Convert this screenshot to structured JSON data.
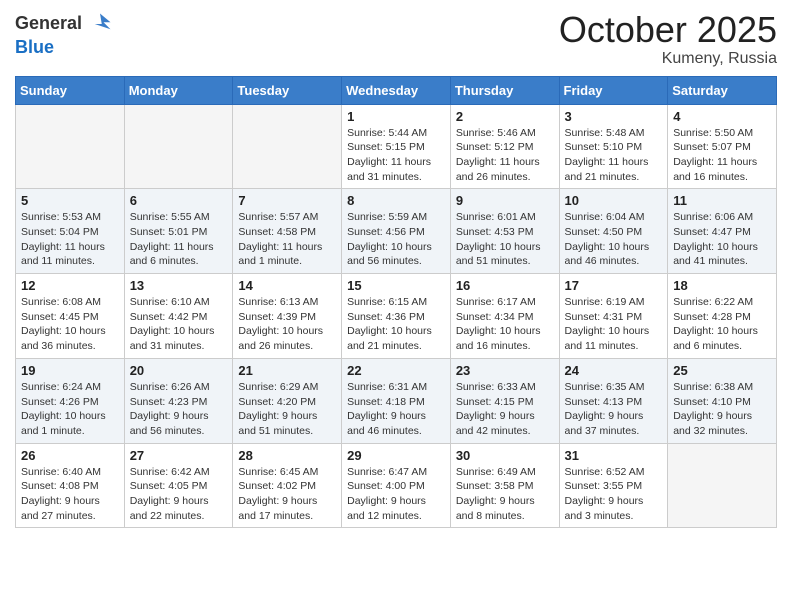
{
  "header": {
    "logo_general": "General",
    "logo_blue": "Blue",
    "month": "October 2025",
    "location": "Kumeny, Russia"
  },
  "weekdays": [
    "Sunday",
    "Monday",
    "Tuesday",
    "Wednesday",
    "Thursday",
    "Friday",
    "Saturday"
  ],
  "weeks": [
    [
      {
        "day": "",
        "info": ""
      },
      {
        "day": "",
        "info": ""
      },
      {
        "day": "",
        "info": ""
      },
      {
        "day": "1",
        "info": "Sunrise: 5:44 AM\nSunset: 5:15 PM\nDaylight: 11 hours\nand 31 minutes."
      },
      {
        "day": "2",
        "info": "Sunrise: 5:46 AM\nSunset: 5:12 PM\nDaylight: 11 hours\nand 26 minutes."
      },
      {
        "day": "3",
        "info": "Sunrise: 5:48 AM\nSunset: 5:10 PM\nDaylight: 11 hours\nand 21 minutes."
      },
      {
        "day": "4",
        "info": "Sunrise: 5:50 AM\nSunset: 5:07 PM\nDaylight: 11 hours\nand 16 minutes."
      }
    ],
    [
      {
        "day": "5",
        "info": "Sunrise: 5:53 AM\nSunset: 5:04 PM\nDaylight: 11 hours\nand 11 minutes."
      },
      {
        "day": "6",
        "info": "Sunrise: 5:55 AM\nSunset: 5:01 PM\nDaylight: 11 hours\nand 6 minutes."
      },
      {
        "day": "7",
        "info": "Sunrise: 5:57 AM\nSunset: 4:58 PM\nDaylight: 11 hours\nand 1 minute."
      },
      {
        "day": "8",
        "info": "Sunrise: 5:59 AM\nSunset: 4:56 PM\nDaylight: 10 hours\nand 56 minutes."
      },
      {
        "day": "9",
        "info": "Sunrise: 6:01 AM\nSunset: 4:53 PM\nDaylight: 10 hours\nand 51 minutes."
      },
      {
        "day": "10",
        "info": "Sunrise: 6:04 AM\nSunset: 4:50 PM\nDaylight: 10 hours\nand 46 minutes."
      },
      {
        "day": "11",
        "info": "Sunrise: 6:06 AM\nSunset: 4:47 PM\nDaylight: 10 hours\nand 41 minutes."
      }
    ],
    [
      {
        "day": "12",
        "info": "Sunrise: 6:08 AM\nSunset: 4:45 PM\nDaylight: 10 hours\nand 36 minutes."
      },
      {
        "day": "13",
        "info": "Sunrise: 6:10 AM\nSunset: 4:42 PM\nDaylight: 10 hours\nand 31 minutes."
      },
      {
        "day": "14",
        "info": "Sunrise: 6:13 AM\nSunset: 4:39 PM\nDaylight: 10 hours\nand 26 minutes."
      },
      {
        "day": "15",
        "info": "Sunrise: 6:15 AM\nSunset: 4:36 PM\nDaylight: 10 hours\nand 21 minutes."
      },
      {
        "day": "16",
        "info": "Sunrise: 6:17 AM\nSunset: 4:34 PM\nDaylight: 10 hours\nand 16 minutes."
      },
      {
        "day": "17",
        "info": "Sunrise: 6:19 AM\nSunset: 4:31 PM\nDaylight: 10 hours\nand 11 minutes."
      },
      {
        "day": "18",
        "info": "Sunrise: 6:22 AM\nSunset: 4:28 PM\nDaylight: 10 hours\nand 6 minutes."
      }
    ],
    [
      {
        "day": "19",
        "info": "Sunrise: 6:24 AM\nSunset: 4:26 PM\nDaylight: 10 hours\nand 1 minute."
      },
      {
        "day": "20",
        "info": "Sunrise: 6:26 AM\nSunset: 4:23 PM\nDaylight: 9 hours\nand 56 minutes."
      },
      {
        "day": "21",
        "info": "Sunrise: 6:29 AM\nSunset: 4:20 PM\nDaylight: 9 hours\nand 51 minutes."
      },
      {
        "day": "22",
        "info": "Sunrise: 6:31 AM\nSunset: 4:18 PM\nDaylight: 9 hours\nand 46 minutes."
      },
      {
        "day": "23",
        "info": "Sunrise: 6:33 AM\nSunset: 4:15 PM\nDaylight: 9 hours\nand 42 minutes."
      },
      {
        "day": "24",
        "info": "Sunrise: 6:35 AM\nSunset: 4:13 PM\nDaylight: 9 hours\nand 37 minutes."
      },
      {
        "day": "25",
        "info": "Sunrise: 6:38 AM\nSunset: 4:10 PM\nDaylight: 9 hours\nand 32 minutes."
      }
    ],
    [
      {
        "day": "26",
        "info": "Sunrise: 6:40 AM\nSunset: 4:08 PM\nDaylight: 9 hours\nand 27 minutes."
      },
      {
        "day": "27",
        "info": "Sunrise: 6:42 AM\nSunset: 4:05 PM\nDaylight: 9 hours\nand 22 minutes."
      },
      {
        "day": "28",
        "info": "Sunrise: 6:45 AM\nSunset: 4:02 PM\nDaylight: 9 hours\nand 17 minutes."
      },
      {
        "day": "29",
        "info": "Sunrise: 6:47 AM\nSunset: 4:00 PM\nDaylight: 9 hours\nand 12 minutes."
      },
      {
        "day": "30",
        "info": "Sunrise: 6:49 AM\nSunset: 3:58 PM\nDaylight: 9 hours\nand 8 minutes."
      },
      {
        "day": "31",
        "info": "Sunrise: 6:52 AM\nSunset: 3:55 PM\nDaylight: 9 hours\nand 3 minutes."
      },
      {
        "day": "",
        "info": ""
      }
    ]
  ]
}
